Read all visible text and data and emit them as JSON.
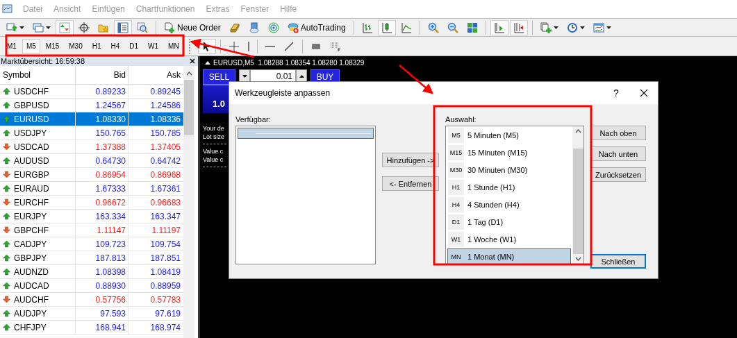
{
  "menu": [
    "Datei",
    "Ansicht",
    "Einfügen",
    "Chartfunktionen",
    "Extras",
    "Fenster",
    "Hilfe"
  ],
  "toolbar_buttons": [
    {
      "pressed": false
    },
    {
      "pressed": false
    },
    {
      "pressed": true
    },
    {
      "pressed": false
    },
    {
      "pressed": false
    },
    {
      "pressed": true
    },
    {
      "pressed": false
    },
    {
      "pressed": false,
      "label": "Neue Order"
    },
    {
      "pressed": false
    },
    {
      "pressed": false
    },
    {
      "pressed": false
    },
    {
      "pressed": false,
      "label": "AutoTrading"
    },
    {
      "pressed": false
    },
    {
      "pressed": true
    },
    {
      "pressed": false
    },
    {
      "pressed": false
    },
    {
      "pressed": false
    },
    {
      "pressed": false
    },
    {
      "pressed": true
    },
    {
      "pressed": true
    },
    {
      "pressed": false
    },
    {
      "pressed": false
    },
    {
      "pressed": false
    }
  ],
  "timeframes": [
    {
      "label": "M1",
      "selected": false
    },
    {
      "label": "M5",
      "selected": true
    },
    {
      "label": "M15",
      "selected": false
    },
    {
      "label": "M30",
      "selected": false
    },
    {
      "label": "H1",
      "selected": false
    },
    {
      "label": "H4",
      "selected": false
    },
    {
      "label": "D1",
      "selected": false
    },
    {
      "label": "W1",
      "selected": false
    },
    {
      "label": "MN",
      "selected": false
    }
  ],
  "draw_tools": [
    {
      "pressed": true
    },
    {
      "pressed": false
    },
    {
      "pressed": false
    },
    {
      "pressed": false
    },
    {
      "pressed": false
    },
    {
      "pressed": false
    },
    {
      "pressed": false
    }
  ],
  "market_watch": {
    "title": "Marktübersicht: 16:59:38",
    "columns": [
      "Symbol",
      "Bid",
      "Ask"
    ],
    "rows": [
      {
        "symbol": "USDCHF",
        "bid": "0.89233",
        "ask": "0.89245",
        "rising": true,
        "selected": false
      },
      {
        "symbol": "GBPUSD",
        "bid": "1.24567",
        "ask": "1.24586",
        "rising": true,
        "selected": false
      },
      {
        "symbol": "EURUSD",
        "bid": "1.08330",
        "ask": "1.08336",
        "rising": true,
        "selected": true
      },
      {
        "symbol": "USDJPY",
        "bid": "150.765",
        "ask": "150.785",
        "rising": true,
        "selected": false
      },
      {
        "symbol": "USDCAD",
        "bid": "1.37388",
        "ask": "1.37405",
        "rising": false,
        "selected": false
      },
      {
        "symbol": "AUDUSD",
        "bid": "0.64730",
        "ask": "0.64742",
        "rising": true,
        "selected": false
      },
      {
        "symbol": "EURGBP",
        "bid": "0.86954",
        "ask": "0.86968",
        "rising": false,
        "selected": false
      },
      {
        "symbol": "EURAUD",
        "bid": "1.67333",
        "ask": "1.67361",
        "rising": true,
        "selected": false
      },
      {
        "symbol": "EURCHF",
        "bid": "0.96672",
        "ask": "0.96683",
        "rising": false,
        "selected": false
      },
      {
        "symbol": "EURJPY",
        "bid": "163.334",
        "ask": "163.347",
        "rising": true,
        "selected": false
      },
      {
        "symbol": "GBPCHF",
        "bid": "1.11147",
        "ask": "1.11197",
        "rising": false,
        "selected": false
      },
      {
        "symbol": "CADJPY",
        "bid": "109.723",
        "ask": "109.754",
        "rising": true,
        "selected": false
      },
      {
        "symbol": "GBPJPY",
        "bid": "187.813",
        "ask": "187.851",
        "rising": true,
        "selected": false
      },
      {
        "symbol": "AUDNZD",
        "bid": "1.08398",
        "ask": "1.08419",
        "rising": true,
        "selected": false
      },
      {
        "symbol": "AUDCAD",
        "bid": "0.88930",
        "ask": "0.88959",
        "rising": true,
        "selected": false
      },
      {
        "symbol": "AUDCHF",
        "bid": "0.57756",
        "ask": "0.57783",
        "rising": false,
        "selected": false
      },
      {
        "symbol": "AUDJPY",
        "bid": "97.593",
        "ask": "97.619",
        "rising": true,
        "selected": false
      },
      {
        "symbol": "CHFJPY",
        "bid": "168.941",
        "ask": "168.974",
        "rising": true,
        "selected": false
      }
    ]
  },
  "chart": {
    "header": "EURUSD,M5  1.08288 1.08354 1.08280 1.08329",
    "sell": "SELL",
    "lot": "0.01",
    "buy": "BUY",
    "price": "1.0",
    "info_lines": [
      "Your de",
      "Lot size",
      "Value c",
      "Value c"
    ]
  },
  "dialog": {
    "title": "Werkzeugleiste anpassen",
    "help": "?",
    "available_label": "Verfügbar:",
    "selection_label": "Auswahl:",
    "add_button": "Hinzufügen ->",
    "remove_button": "<- Entfernen",
    "available_items": [
      {
        "kind": "separator",
        "selected": true
      }
    ],
    "selection_items": [
      {
        "code": "M5",
        "label": "5 Minuten (M5)",
        "selected": false
      },
      {
        "code": "M15",
        "label": "15 Minuten (M15)",
        "selected": false
      },
      {
        "code": "M30",
        "label": "30 Minuten (M30)",
        "selected": false
      },
      {
        "code": "H1",
        "label": "1 Stunde (H1)",
        "selected": false
      },
      {
        "code": "H4",
        "label": "4 Stunden (H4)",
        "selected": false
      },
      {
        "code": "D1",
        "label": "1 Tag (D1)",
        "selected": false
      },
      {
        "code": "W1",
        "label": "1 Woche (W1)",
        "selected": false
      },
      {
        "code": "MN",
        "label": "1 Monat (MN)",
        "selected": true
      }
    ],
    "side_buttons": [
      "Nach oben",
      "Nach unten",
      "Zurücksetzen"
    ],
    "close_button": "Schließen"
  }
}
